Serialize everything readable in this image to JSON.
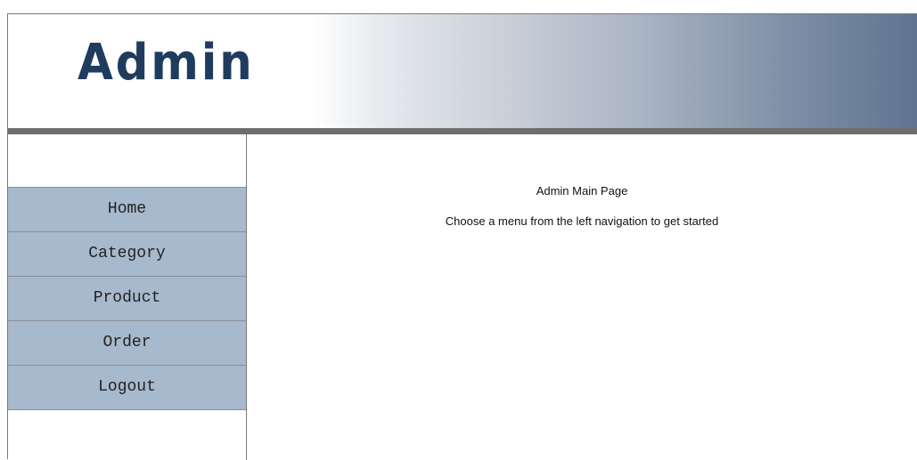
{
  "header": {
    "logo_text": "Admin"
  },
  "sidebar": {
    "items": [
      {
        "label": "Home"
      },
      {
        "label": "Category"
      },
      {
        "label": "Product"
      },
      {
        "label": "Order"
      },
      {
        "label": "Logout"
      }
    ]
  },
  "main": {
    "title": "Admin Main Page",
    "subtitle": "Choose a menu from the left navigation to get started"
  },
  "colors": {
    "logo": "#1f3c5f",
    "nav_item_bg": "#a7b9cc",
    "header_gradient_end": "#5f7590",
    "header_rule": "#6e6e6e"
  }
}
